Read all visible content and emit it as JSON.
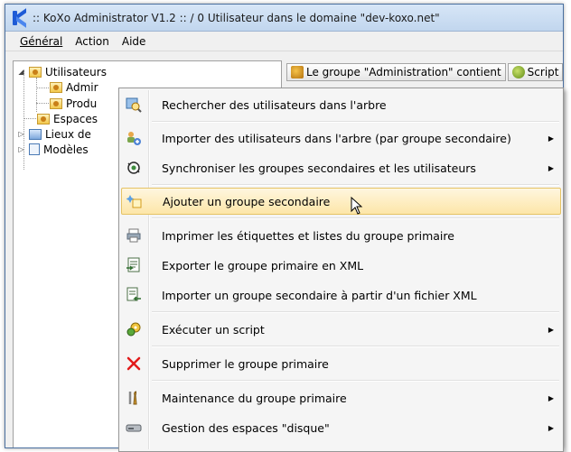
{
  "window": {
    "title": ":: KoXo Administrator V1.2 :: / 0 Utilisateur dans le domaine \"dev-koxo.net\""
  },
  "menubar": {
    "items": [
      "Général",
      "Action",
      "Aide"
    ]
  },
  "tree": {
    "items": [
      {
        "label": "Utilisateurs",
        "icon": "group-folder-icon"
      },
      {
        "label": "Admir",
        "icon": "group-folder-icon"
      },
      {
        "label": "Produ",
        "icon": "group-folder-icon"
      },
      {
        "label": "Espaces",
        "icon": "spaces-icon"
      },
      {
        "label": "Lieux de",
        "icon": "places-icon"
      },
      {
        "label": "Modèles",
        "icon": "template-icon"
      }
    ]
  },
  "toolbar": {
    "group_info": "Le groupe \"Administration\" contient",
    "script_label": "Script"
  },
  "context_menu": {
    "items": [
      {
        "label": "Rechercher des utilisateurs dans l'arbre",
        "icon": "search-users-icon",
        "submenu": false
      },
      {
        "label": "Importer des utilisateurs dans l'arbre (par groupe secondaire)",
        "icon": "import-users-icon",
        "submenu": true
      },
      {
        "label": "Synchroniser les groupes secondaires et les utilisateurs",
        "icon": "sync-icon",
        "submenu": true
      },
      {
        "label": "Ajouter un groupe secondaire",
        "icon": "add-group-icon",
        "submenu": false,
        "highlighted": true
      },
      {
        "label": "Imprimer les étiquettes et listes du groupe primaire",
        "icon": "print-icon",
        "submenu": false
      },
      {
        "label": "Exporter le groupe primaire en XML",
        "icon": "export-xml-icon",
        "submenu": false
      },
      {
        "label": "Importer un groupe secondaire à partir d'un fichier XML",
        "icon": "import-xml-icon",
        "submenu": false
      },
      {
        "label": "Exécuter un script",
        "icon": "script-icon",
        "submenu": true
      },
      {
        "label": "Supprimer le groupe primaire",
        "icon": "delete-icon",
        "submenu": false
      },
      {
        "label": "Maintenance du groupe primaire",
        "icon": "maintenance-icon",
        "submenu": true
      },
      {
        "label": "Gestion des espaces \"disque\"",
        "icon": "disk-icon",
        "submenu": true
      }
    ]
  }
}
